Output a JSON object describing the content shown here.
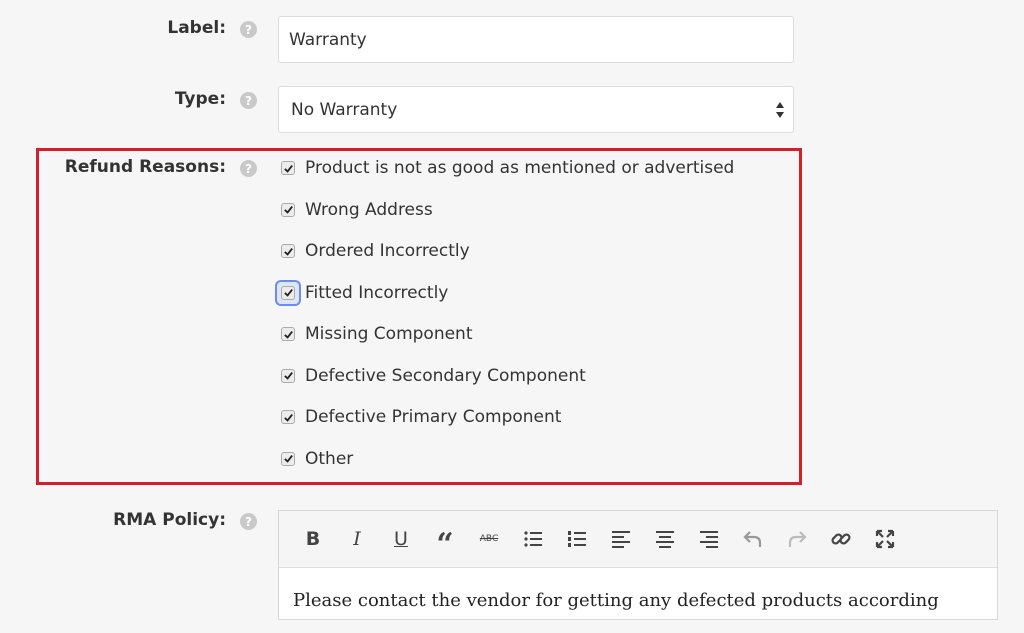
{
  "label_field": {
    "label": "Label:",
    "value": "Warranty"
  },
  "type_field": {
    "label": "Type:",
    "selected": "No Warranty"
  },
  "refund_reasons": {
    "label": "Refund Reasons:",
    "items": [
      {
        "text": "Product is not as good as mentioned or advertised",
        "checked": true
      },
      {
        "text": "Wrong Address",
        "checked": true
      },
      {
        "text": "Ordered Incorrectly",
        "checked": true
      },
      {
        "text": "Fitted Incorrectly",
        "checked": true,
        "focused": true
      },
      {
        "text": "Missing Component",
        "checked": true
      },
      {
        "text": "Defective Secondary Component",
        "checked": true
      },
      {
        "text": "Defective Primary Component",
        "checked": true
      },
      {
        "text": "Other",
        "checked": true
      }
    ]
  },
  "rma_policy": {
    "label": "RMA Policy:",
    "toolbar": {
      "bold": "B",
      "italic": "I",
      "underline": "U",
      "blockquote": "“",
      "strikethrough": "ABC"
    },
    "content": "Please contact the vendor for getting any defected products according"
  },
  "help_icon_glyph": "?",
  "colors": {
    "highlight": "#d0202a",
    "focus": "#6a8cf0"
  }
}
